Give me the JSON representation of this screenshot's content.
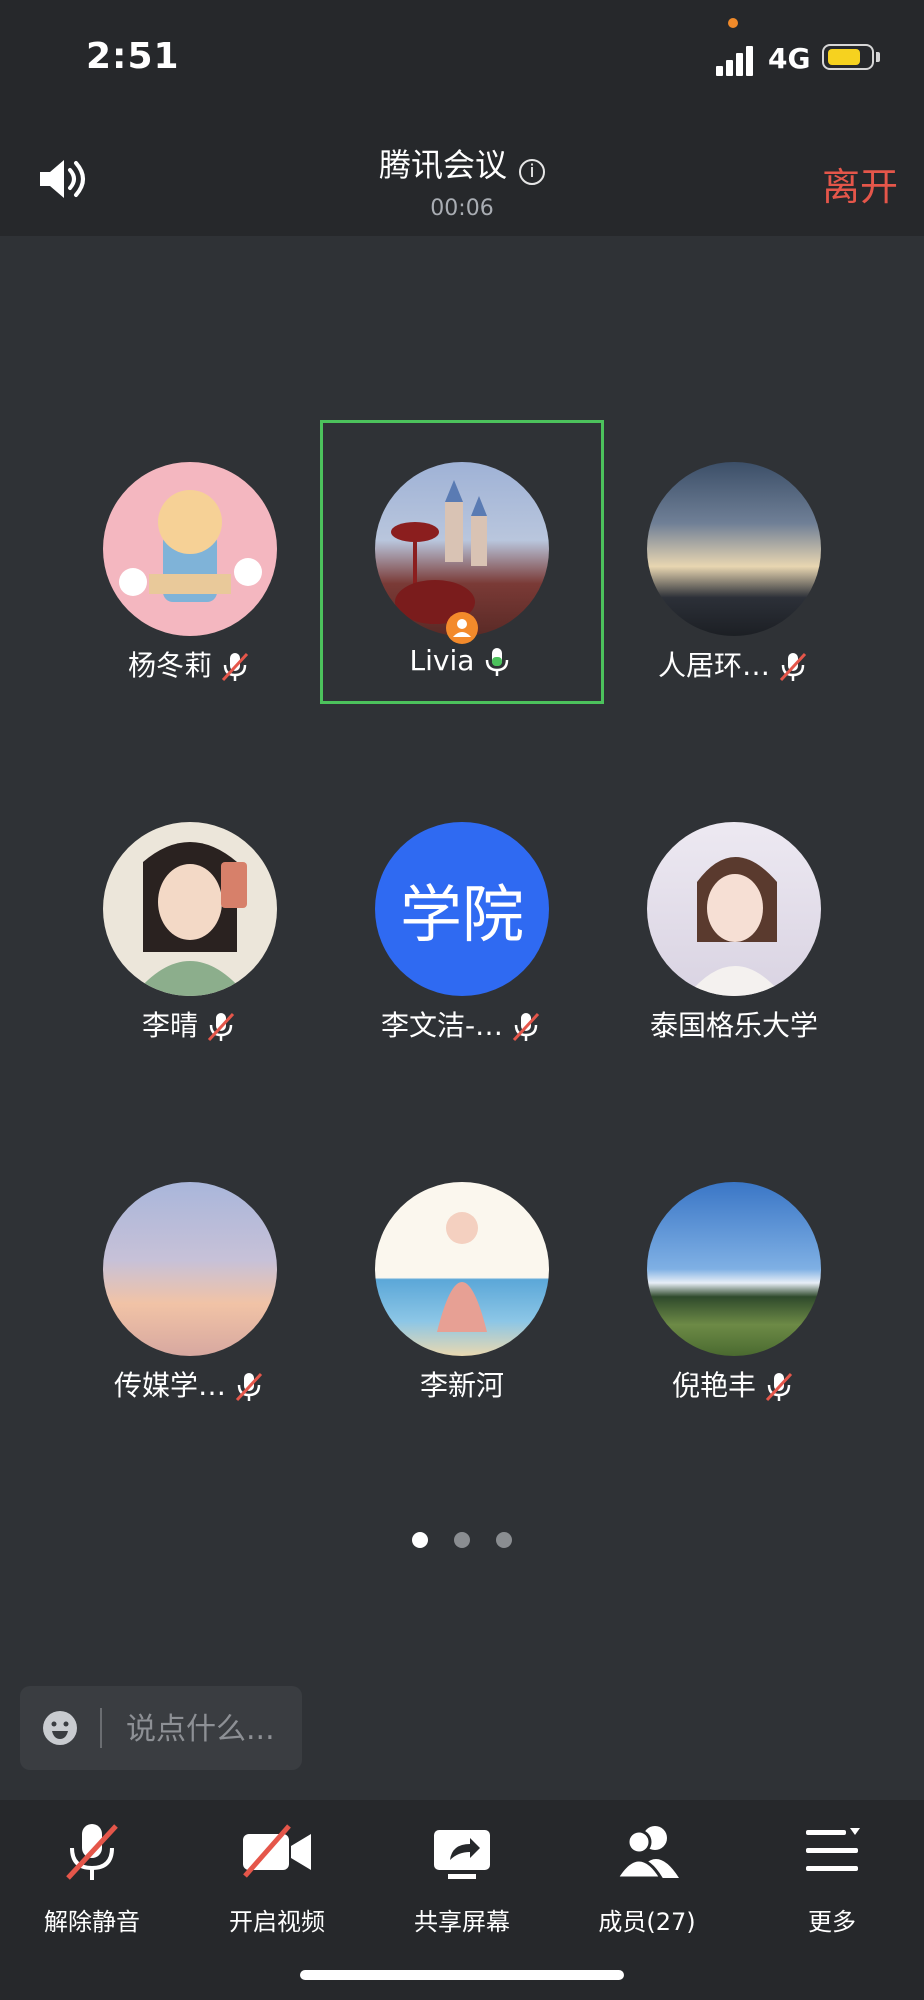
{
  "status_bar": {
    "time": "2:51",
    "network": "4G"
  },
  "header": {
    "title": "腾讯会议",
    "timer": "00:06",
    "leave_label": "离开"
  },
  "participants": [
    {
      "name": "杨冬莉",
      "muted": true,
      "avatar_colors": [
        "#f9d4d6",
        "#f5b6be"
      ]
    },
    {
      "name": "Livia",
      "muted": false,
      "speaking": true,
      "host": true,
      "avatar_colors": [
        "#a8b9d8",
        "#7a3a36"
      ]
    },
    {
      "name": "人居环…",
      "muted": true,
      "avatar_colors": [
        "#35485f",
        "#e9d7b3"
      ]
    },
    {
      "name": "李晴",
      "muted": true,
      "avatar_colors": [
        "#e8e2d6",
        "#8cae8c"
      ]
    },
    {
      "name": "李文洁-…",
      "muted": true,
      "avatar_text": "学院",
      "avatar_colors": [
        "#2f6af2",
        "#2f6af2"
      ]
    },
    {
      "name": "泰国格乐大学",
      "muted": false,
      "avatar_colors": [
        "#e9e6ef",
        "#c9c3d6"
      ]
    },
    {
      "name": "传媒学…",
      "muted": true,
      "avatar_colors": [
        "#aab4d8",
        "#f2c4a8"
      ]
    },
    {
      "name": "李新河",
      "muted": false,
      "avatar_colors": [
        "#fbf7ee",
        "#5ba7d8"
      ]
    },
    {
      "name": "倪艳丰",
      "muted": true,
      "avatar_colors": [
        "#3d78c8",
        "#4c7a3a"
      ]
    }
  ],
  "pagination": {
    "pages": 3,
    "current": 1
  },
  "chat": {
    "placeholder": "说点什么..."
  },
  "toolbar": {
    "unmute_label": "解除静音",
    "video_label": "开启视频",
    "share_label": "共享屏幕",
    "members_label": "成员(27)",
    "more_label": "更多"
  },
  "colors": {
    "accent_green": "#4cc25c",
    "leave_red": "#e5564a",
    "mute_red": "#e5564a",
    "brand_blue": "#2f6af2"
  }
}
